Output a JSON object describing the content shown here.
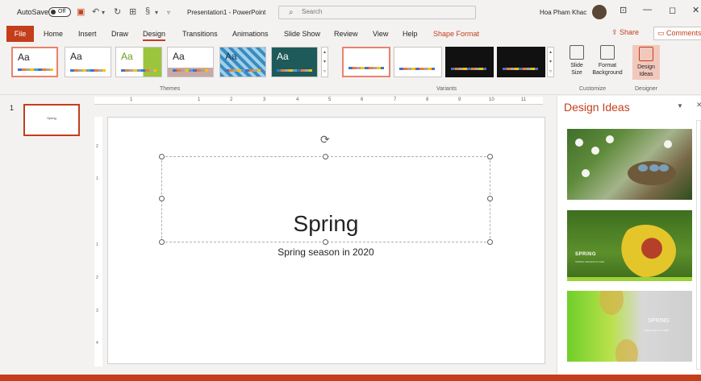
{
  "titlebar": {
    "autosave_label": "AutoSave",
    "autosave_state": "Off",
    "document_title": "Presentation1 - PowerPoint",
    "search_placeholder": "Search",
    "user_name": "Hoa Pham Khac"
  },
  "tabs": {
    "file": "File",
    "items": [
      "Home",
      "Insert",
      "Draw",
      "Design",
      "Transitions",
      "Animations",
      "Slide Show",
      "Review",
      "View",
      "Help",
      "Shape Format"
    ],
    "active": "Design",
    "share": "Share",
    "comments": "Comments"
  },
  "ribbon": {
    "themes": [
      "Aa",
      "Aa",
      "Aa",
      "Aa",
      "Aa",
      "Aa"
    ],
    "themes_label": "Themes",
    "variants_label": "Variants",
    "slide_size": "Slide Size",
    "format_background": "Format Background",
    "customize_label": "Customize",
    "design_ideas": "Design Ideas",
    "designer_label": "Designer"
  },
  "slides_pane": {
    "slide_number": "1",
    "thumb_text": "Spring"
  },
  "ruler": {
    "h_ticks": [
      "1",
      "1",
      "2",
      "3",
      "4",
      "5",
      "6",
      "7",
      "8",
      "9",
      "10",
      "11"
    ],
    "v_ticks": [
      "2",
      "1",
      "1",
      "2",
      "3",
      "4"
    ]
  },
  "slide": {
    "title": "Spring",
    "subtitle": "Spring season in 2020"
  },
  "design_ideas_pane": {
    "title": "Design Ideas",
    "idea2_label": "SPRING",
    "idea2_sub": "SPRING SEASON IN 2020",
    "idea3_label": "SPRING",
    "idea3_sub": "Spring season in 2020"
  },
  "colors": {
    "accent": "#c43e1c",
    "ribbon_bg": "#f3f2f1"
  }
}
